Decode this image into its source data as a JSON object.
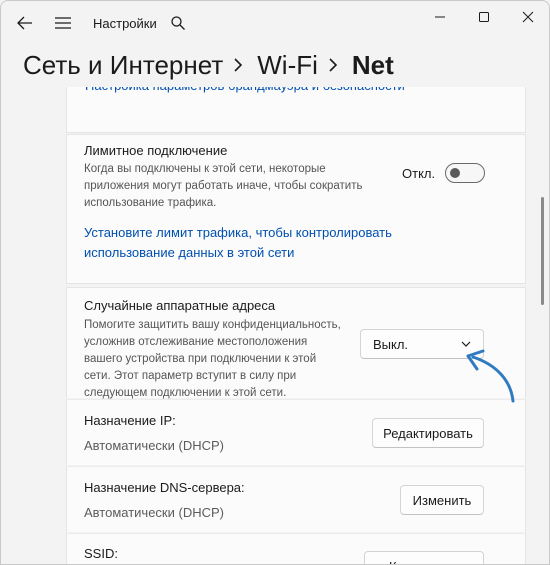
{
  "app_title": "Настройки",
  "breadcrumb": [
    "Сеть и Интернет",
    "Wi-Fi",
    "Net"
  ],
  "firewall_link": "Настройка параметров брандмауэра и безопасности",
  "metered": {
    "title": "Лимитное подключение",
    "description": [
      "Когда вы подключены к этой сети, некоторые",
      "приложения могут работать иначе, чтобы сократить",
      "использование трафика."
    ],
    "toggle_label": "Откл.",
    "toggle_on": false,
    "limit_link": [
      "Установите лимит трафика, чтобы контролировать",
      "использование данных в этой сети"
    ]
  },
  "random_hw": {
    "title": "Случайные аппаратные адреса",
    "description": [
      "Помогите защитить вашу конфиденциальность,",
      "усложнив отслеживание местоположения",
      "вашего устройства при подключении к этой",
      "сети. Этот параметр вступит в силу при",
      "следующем подключении к этой сети."
    ],
    "dropdown_value": "Выкл."
  },
  "ip": {
    "title": "Назначение IP:",
    "value": "Автоматически (DHCP)",
    "button": "Редактировать"
  },
  "dns": {
    "title": "Назначение DNS-сервера:",
    "value": "Автоматически (DHCP)",
    "button": "Изменить"
  },
  "ssid": {
    "title": "SSID:",
    "button": "Копировать"
  },
  "colors": {
    "link": "#0050b0",
    "annotation_arrow": "#2f7bc2"
  },
  "icons": [
    "back-arrow-icon",
    "hamburger-menu-icon",
    "search-icon",
    "minimize-icon",
    "maximize-icon",
    "close-icon",
    "chevron-right-icon",
    "chevron-down-icon"
  ]
}
